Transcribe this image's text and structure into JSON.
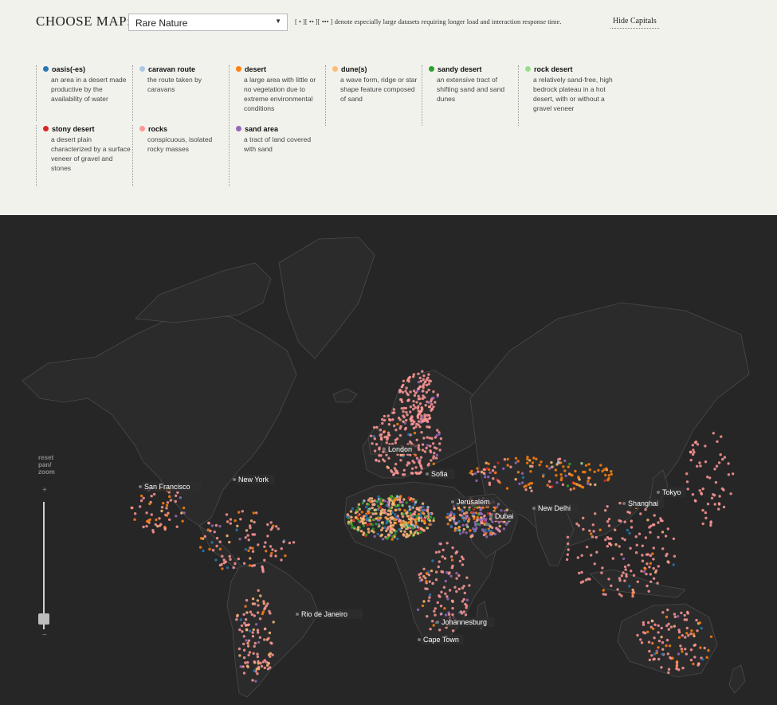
{
  "header": {
    "choose_label": "CHOOSE MAP:",
    "selected_map": "Rare Nature",
    "note": "[ • ][ •• ][ ••• ] denote especially large datasets requiring longer load and interaction response time.",
    "hide_capitals": "Hide Capitals"
  },
  "legend": [
    {
      "name": "oasis(-es)",
      "desc": "an area in a desert made productive by the availability of water",
      "color": "#2878b5"
    },
    {
      "name": "caravan route",
      "desc": "the route taken by caravans",
      "color": "#aec7e8"
    },
    {
      "name": "desert",
      "desc": "a large area with little or no vegetation due to extreme environmental conditions",
      "color": "#ff7f0e"
    },
    {
      "name": "dune(s)",
      "desc": "a wave form, ridge or star shape feature composed of sand",
      "color": "#ffbb78"
    },
    {
      "name": "sandy desert",
      "desc": "an extensive tract of shifting sand and sand dunes",
      "color": "#2ca02c"
    },
    {
      "name": "rock desert",
      "desc": "a relatively sand-free, high bedrock plateau in a hot desert, with or without a gravel veneer",
      "color": "#98df8a"
    },
    {
      "name": "stony desert",
      "desc": "a desert plain characterized by a surface veneer of gravel and stones",
      "color": "#d62728"
    },
    {
      "name": "rocks",
      "desc": "conspicuous, isolated rocky masses",
      "color": "#ff9896"
    },
    {
      "name": "sand area",
      "desc": "a tract of land covered with sand",
      "color": "#9467bd"
    }
  ],
  "map": {
    "reset_label": [
      "reset",
      "pan/",
      "zoom"
    ],
    "zoom_in": "+",
    "zoom_out": "−",
    "cities": [
      {
        "name": "London"
      },
      {
        "name": "Sofia"
      },
      {
        "name": "San Francisco"
      },
      {
        "name": "New York"
      },
      {
        "name": "Jerusalem"
      },
      {
        "name": "New Delhi"
      },
      {
        "name": "Dubai"
      },
      {
        "name": "Shanghai"
      },
      {
        "name": "Tokyo"
      },
      {
        "name": "Rio de Janeiro"
      },
      {
        "name": "Johannesburg"
      },
      {
        "name": "Cape Town"
      }
    ]
  }
}
